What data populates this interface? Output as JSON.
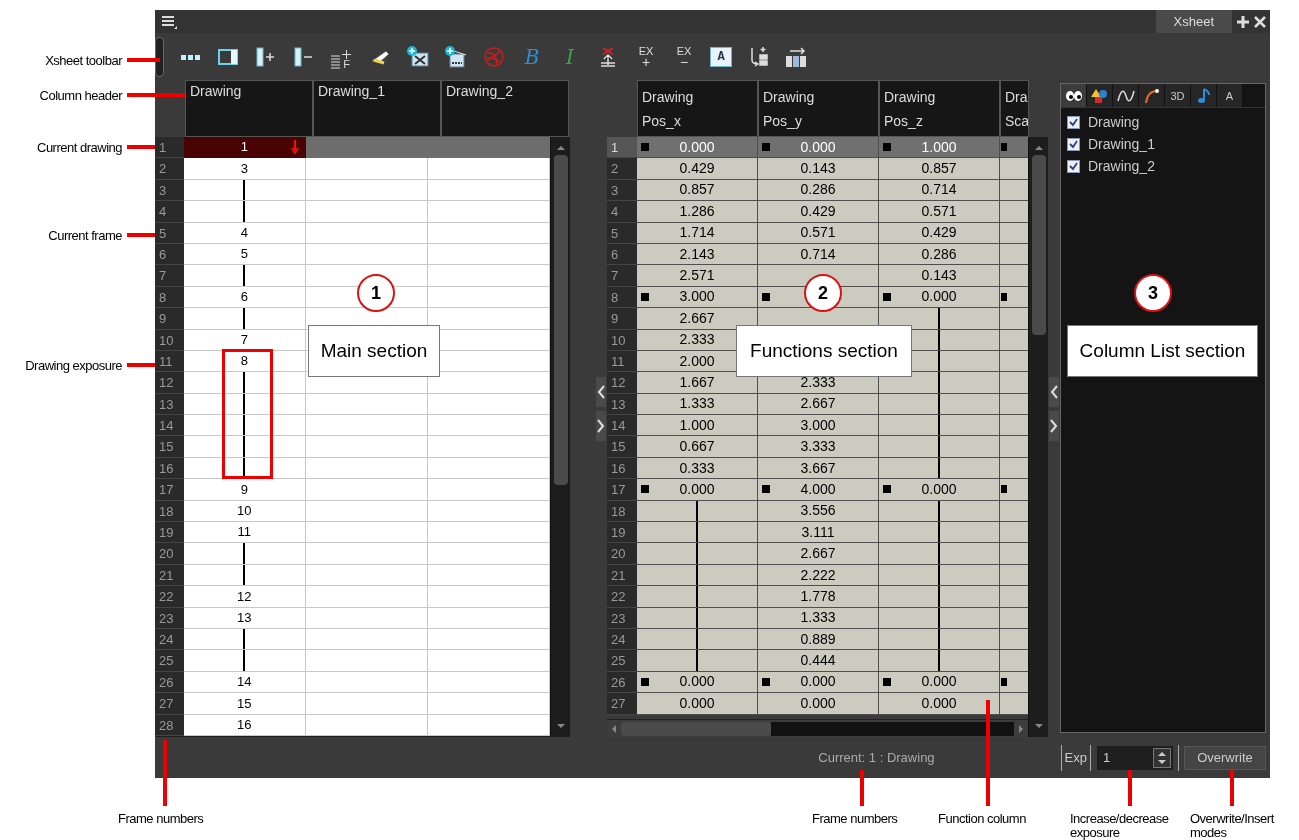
{
  "window": {
    "tab": "Xsheet"
  },
  "toolbar": [
    {
      "kind": "dots"
    },
    {
      "kind": "panel"
    },
    {
      "kind": "col-add"
    },
    {
      "kind": "col-remove"
    },
    {
      "kind": "lines",
      "label": "F"
    },
    {
      "kind": "scanner"
    },
    {
      "kind": "image-add"
    },
    {
      "kind": "image-export"
    },
    {
      "kind": "swirl"
    },
    {
      "kind": "script",
      "text": "B",
      "color": "#2a8fd6"
    },
    {
      "kind": "script",
      "text": "I",
      "color": "#36a84a"
    },
    {
      "kind": "stamp"
    },
    {
      "kind": "ex",
      "label": "EX",
      "sign": "+"
    },
    {
      "kind": "ex",
      "label": "EX",
      "sign": "−"
    },
    {
      "kind": "boxed",
      "label": "A"
    },
    {
      "kind": "insert-arrow"
    },
    {
      "kind": "columns-arrow"
    }
  ],
  "main": {
    "columns": [
      "Drawing",
      "Drawing_1",
      "Drawing_2"
    ],
    "rows": [
      {
        "frame": "1",
        "current": true,
        "cell": {
          "kind": "value",
          "value": "1"
        }
      },
      {
        "frame": "2",
        "current": false,
        "cell": {
          "kind": "value",
          "value": "3"
        }
      },
      {
        "frame": "3",
        "current": false,
        "cell": {
          "kind": "hold"
        }
      },
      {
        "frame": "4",
        "current": false,
        "cell": {
          "kind": "hold"
        }
      },
      {
        "frame": "5",
        "current": false,
        "cell": {
          "kind": "value",
          "value": "4"
        }
      },
      {
        "frame": "6",
        "current": false,
        "cell": {
          "kind": "value",
          "value": "5"
        }
      },
      {
        "frame": "7",
        "current": false,
        "cell": {
          "kind": "hold"
        }
      },
      {
        "frame": "8",
        "current": false,
        "cell": {
          "kind": "value",
          "value": "6"
        }
      },
      {
        "frame": "9",
        "current": false,
        "cell": {
          "kind": "hold"
        }
      },
      {
        "frame": "10",
        "current": false,
        "cell": {
          "kind": "value",
          "value": "7"
        }
      },
      {
        "frame": "11",
        "current": false,
        "cell": {
          "kind": "value",
          "value": "8"
        }
      },
      {
        "frame": "12",
        "current": false,
        "cell": {
          "kind": "hold"
        }
      },
      {
        "frame": "13",
        "current": false,
        "cell": {
          "kind": "hold"
        }
      },
      {
        "frame": "14",
        "current": false,
        "cell": {
          "kind": "hold"
        }
      },
      {
        "frame": "15",
        "current": false,
        "cell": {
          "kind": "hold"
        }
      },
      {
        "frame": "16",
        "current": false,
        "cell": {
          "kind": "hold"
        }
      },
      {
        "frame": "17",
        "current": false,
        "cell": {
          "kind": "value",
          "value": "9"
        }
      },
      {
        "frame": "18",
        "current": false,
        "cell": {
          "kind": "value",
          "value": "10"
        }
      },
      {
        "frame": "19",
        "current": false,
        "cell": {
          "kind": "value",
          "value": "11"
        }
      },
      {
        "frame": "20",
        "current": false,
        "cell": {
          "kind": "hold"
        }
      },
      {
        "frame": "21",
        "current": false,
        "cell": {
          "kind": "hold"
        }
      },
      {
        "frame": "22",
        "current": false,
        "cell": {
          "kind": "value",
          "value": "12"
        }
      },
      {
        "frame": "23",
        "current": false,
        "cell": {
          "kind": "value",
          "value": "13"
        }
      },
      {
        "frame": "24",
        "current": false,
        "cell": {
          "kind": "hold"
        }
      },
      {
        "frame": "25",
        "current": false,
        "cell": {
          "kind": "hold"
        }
      },
      {
        "frame": "26",
        "current": false,
        "cell": {
          "kind": "value",
          "value": "14"
        }
      },
      {
        "frame": "27",
        "current": false,
        "cell": {
          "kind": "value",
          "value": "15"
        }
      },
      {
        "frame": "28",
        "current": false,
        "cell": {
          "kind": "value",
          "value": "16"
        }
      }
    ]
  },
  "functions": {
    "columns": [
      {
        "line_1": "Drawing",
        "line_2": "Pos_x"
      },
      {
        "line_1": "Drawing",
        "line_2": "Pos_y"
      },
      {
        "line_1": "Drawing",
        "line_2": "Pos_z"
      },
      {
        "line_1": "Dra",
        "line_2": "Sca"
      }
    ],
    "rows": [
      {
        "frame": "1",
        "current": true,
        "cells": [
          {
            "kind": "key",
            "value": "0.000"
          },
          {
            "kind": "key",
            "value": "0.000"
          },
          {
            "kind": "key",
            "value": "1.000"
          },
          {
            "kind": "key"
          }
        ]
      },
      {
        "frame": "2",
        "current": false,
        "cells": [
          {
            "kind": "value",
            "value": "0.429"
          },
          {
            "kind": "value",
            "value": "0.143"
          },
          {
            "kind": "value",
            "value": "0.857"
          },
          {
            "kind": "empty"
          }
        ]
      },
      {
        "frame": "3",
        "current": false,
        "cells": [
          {
            "kind": "value",
            "value": "0.857"
          },
          {
            "kind": "value",
            "value": "0.286"
          },
          {
            "kind": "value",
            "value": "0.714"
          },
          {
            "kind": "empty"
          }
        ]
      },
      {
        "frame": "4",
        "current": false,
        "cells": [
          {
            "kind": "value",
            "value": "1.286"
          },
          {
            "kind": "value",
            "value": "0.429"
          },
          {
            "kind": "value",
            "value": "0.571"
          },
          {
            "kind": "empty"
          }
        ]
      },
      {
        "frame": "5",
        "current": false,
        "cells": [
          {
            "kind": "value",
            "value": "1.714"
          },
          {
            "kind": "value",
            "value": "0.571"
          },
          {
            "kind": "value",
            "value": "0.429"
          },
          {
            "kind": "empty"
          }
        ]
      },
      {
        "frame": "6",
        "current": false,
        "cells": [
          {
            "kind": "value",
            "value": "2.143"
          },
          {
            "kind": "value",
            "value": "0.714"
          },
          {
            "kind": "value",
            "value": "0.286"
          },
          {
            "kind": "empty"
          }
        ]
      },
      {
        "frame": "7",
        "current": false,
        "cells": [
          {
            "kind": "value",
            "value": "2.571"
          },
          {
            "kind": "empty"
          },
          {
            "kind": "value",
            "value": "0.143"
          },
          {
            "kind": "empty"
          }
        ]
      },
      {
        "frame": "8",
        "current": false,
        "cells": [
          {
            "kind": "key",
            "value": "3.000"
          },
          {
            "kind": "key"
          },
          {
            "kind": "key",
            "value": "0.000"
          },
          {
            "kind": "key"
          }
        ]
      },
      {
        "frame": "9",
        "current": false,
        "cells": [
          {
            "kind": "value",
            "value": "2.667"
          },
          {
            "kind": "empty"
          },
          {
            "kind": "hold"
          },
          {
            "kind": "empty"
          }
        ]
      },
      {
        "frame": "10",
        "current": false,
        "cells": [
          {
            "kind": "value",
            "value": "2.333"
          },
          {
            "kind": "empty"
          },
          {
            "kind": "hold"
          },
          {
            "kind": "empty"
          }
        ]
      },
      {
        "frame": "11",
        "current": false,
        "cells": [
          {
            "kind": "value",
            "value": "2.000"
          },
          {
            "kind": "empty"
          },
          {
            "kind": "hold"
          },
          {
            "kind": "empty"
          }
        ]
      },
      {
        "frame": "12",
        "current": false,
        "cells": [
          {
            "kind": "value",
            "value": "1.667"
          },
          {
            "kind": "value",
            "value": "2.333"
          },
          {
            "kind": "hold"
          },
          {
            "kind": "empty"
          }
        ]
      },
      {
        "frame": "13",
        "current": false,
        "cells": [
          {
            "kind": "value",
            "value": "1.333"
          },
          {
            "kind": "value",
            "value": "2.667"
          },
          {
            "kind": "hold"
          },
          {
            "kind": "empty"
          }
        ]
      },
      {
        "frame": "14",
        "current": false,
        "cells": [
          {
            "kind": "value",
            "value": "1.000"
          },
          {
            "kind": "value",
            "value": "3.000"
          },
          {
            "kind": "hold"
          },
          {
            "kind": "empty"
          }
        ]
      },
      {
        "frame": "15",
        "current": false,
        "cells": [
          {
            "kind": "value",
            "value": "0.667"
          },
          {
            "kind": "value",
            "value": "3.333"
          },
          {
            "kind": "hold"
          },
          {
            "kind": "empty"
          }
        ]
      },
      {
        "frame": "16",
        "current": false,
        "cells": [
          {
            "kind": "value",
            "value": "0.333"
          },
          {
            "kind": "value",
            "value": "3.667"
          },
          {
            "kind": "hold"
          },
          {
            "kind": "empty"
          }
        ]
      },
      {
        "frame": "17",
        "current": false,
        "cells": [
          {
            "kind": "key",
            "value": "0.000"
          },
          {
            "kind": "key",
            "value": "4.000"
          },
          {
            "kind": "key",
            "value": "0.000"
          },
          {
            "kind": "key"
          }
        ]
      },
      {
        "frame": "18",
        "current": false,
        "cells": [
          {
            "kind": "hold"
          },
          {
            "kind": "value",
            "value": "3.556"
          },
          {
            "kind": "hold"
          },
          {
            "kind": "empty"
          }
        ]
      },
      {
        "frame": "19",
        "current": false,
        "cells": [
          {
            "kind": "hold"
          },
          {
            "kind": "value",
            "value": "3.111"
          },
          {
            "kind": "hold"
          },
          {
            "kind": "empty"
          }
        ]
      },
      {
        "frame": "20",
        "current": false,
        "cells": [
          {
            "kind": "hold"
          },
          {
            "kind": "value",
            "value": "2.667"
          },
          {
            "kind": "hold"
          },
          {
            "kind": "empty"
          }
        ]
      },
      {
        "frame": "21",
        "current": false,
        "cells": [
          {
            "kind": "hold"
          },
          {
            "kind": "value",
            "value": "2.222"
          },
          {
            "kind": "hold"
          },
          {
            "kind": "empty"
          }
        ]
      },
      {
        "frame": "22",
        "current": false,
        "cells": [
          {
            "kind": "hold"
          },
          {
            "kind": "value",
            "value": "1.778"
          },
          {
            "kind": "hold"
          },
          {
            "kind": "empty"
          }
        ]
      },
      {
        "frame": "23",
        "current": false,
        "cells": [
          {
            "kind": "hold"
          },
          {
            "kind": "value",
            "value": "1.333"
          },
          {
            "kind": "hold"
          },
          {
            "kind": "empty"
          }
        ]
      },
      {
        "frame": "24",
        "current": false,
        "cells": [
          {
            "kind": "hold"
          },
          {
            "kind": "value",
            "value": "0.889"
          },
          {
            "kind": "hold"
          },
          {
            "kind": "empty"
          }
        ]
      },
      {
        "frame": "25",
        "current": false,
        "cells": [
          {
            "kind": "hold"
          },
          {
            "kind": "value",
            "value": "0.444"
          },
          {
            "kind": "hold"
          },
          {
            "kind": "empty"
          }
        ]
      },
      {
        "frame": "26",
        "current": false,
        "cells": [
          {
            "kind": "key",
            "value": "0.000"
          },
          {
            "kind": "key",
            "value": "0.000"
          },
          {
            "kind": "key",
            "value": "0.000"
          },
          {
            "kind": "key"
          }
        ]
      },
      {
        "frame": "27",
        "current": false,
        "cells": [
          {
            "kind": "value",
            "value": "0.000"
          },
          {
            "kind": "value",
            "value": "0.000"
          },
          {
            "kind": "value",
            "value": "0.000"
          },
          {
            "kind": "empty"
          }
        ]
      }
    ]
  },
  "column_list": {
    "tabs": [
      {
        "kind": "eyes",
        "selected": true
      },
      {
        "kind": "shapes",
        "selected": false
      },
      {
        "kind": "curve",
        "selected": false
      },
      {
        "kind": "swoosh",
        "selected": false
      },
      {
        "kind": "text",
        "label": "3D",
        "selected": false
      },
      {
        "kind": "note",
        "selected": false
      },
      {
        "kind": "text",
        "label": "A",
        "selected": false
      }
    ],
    "items": [
      {
        "label": "Drawing",
        "checked": true
      },
      {
        "label": "Drawing_1",
        "checked": true
      },
      {
        "label": "Drawing_2",
        "checked": true
      }
    ]
  },
  "status_bar": {
    "current": "Current: 1 : Drawing",
    "exp_label": "Exp",
    "exp_value": "1",
    "mode_button": "Overwrite"
  },
  "callouts": [
    {
      "number": "1",
      "label": "Main section"
    },
    {
      "number": "2",
      "label": "Functions section"
    },
    {
      "number": "3",
      "label": "Column List section"
    }
  ],
  "annotations": {
    "left": [
      "Xsheet toolbar",
      "Column header",
      "Current drawing",
      "Current frame",
      "Drawing exposure"
    ],
    "bottom": [
      "Frame numbers",
      "Frame numbers",
      "Function column",
      "Increase/decrease exposure",
      "Overwrite/Insert modes"
    ]
  }
}
